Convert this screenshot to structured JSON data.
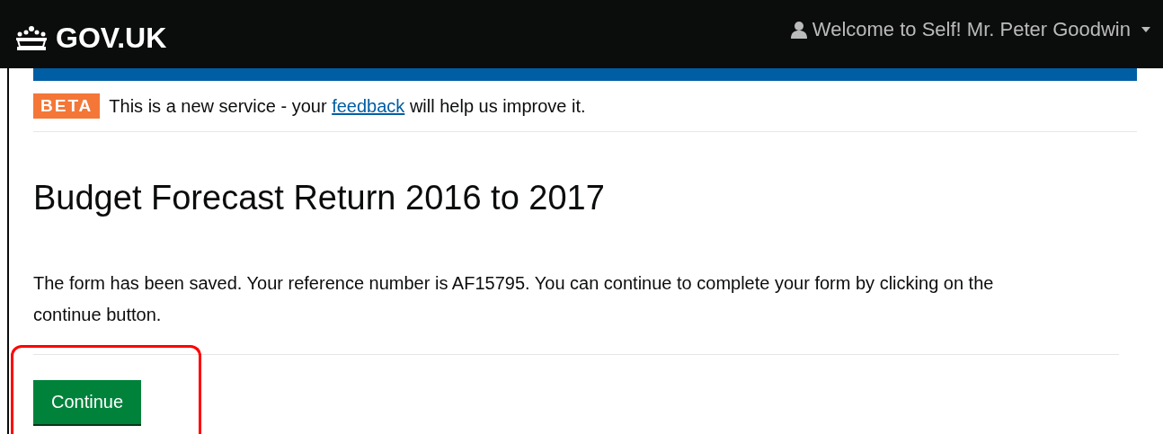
{
  "header": {
    "logo": "GOV.UK",
    "user_menu": "Welcome to Self! Mr. Peter Goodwin"
  },
  "phase_banner": {
    "tag": "BETA",
    "text_before": "This is a new service - your",
    "link": "feedback",
    "text_after": "will help us improve it."
  },
  "heading": "Budget Forecast Return 2016 to 2017",
  "message": "The form has been saved. Your reference number is AF15795. You can continue to complete your form by clicking on the continue button.",
  "continue_button": {
    "label": "Continue",
    "highlighted": true
  }
}
